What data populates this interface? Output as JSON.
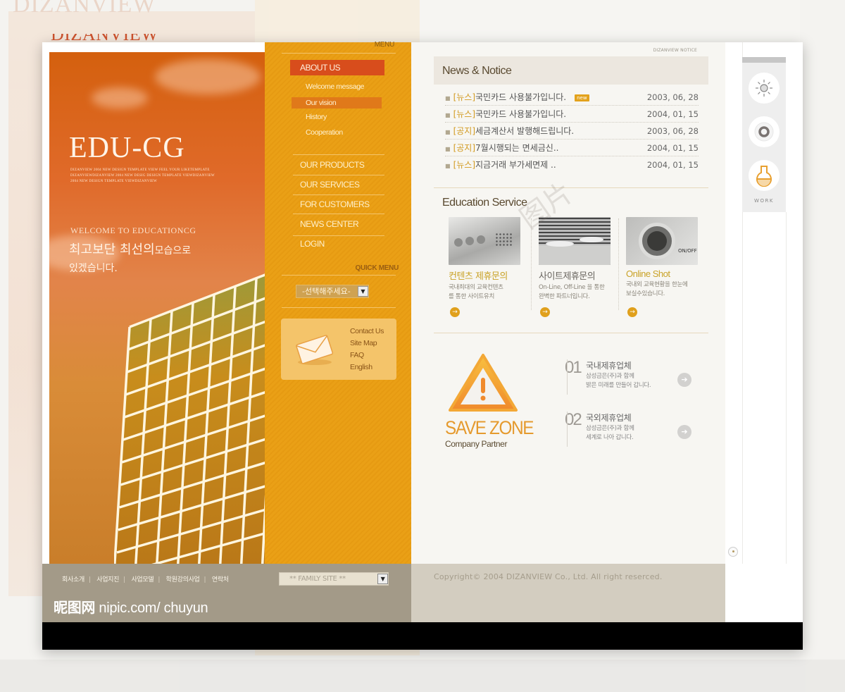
{
  "brand": {
    "logo": "DIZANVIEW"
  },
  "hero": {
    "title": "EDU-CG",
    "fine_print": "DIZANVIEW 2004 NEW DESIGN TEMPLATE VIEW FEEL YOUR LIKETEMPLATE DIZANVIEWDIZANVIEW 2004 NEW DESIG DESIGN TEMPLATE VIEWDIZANVIEW 2004 NEW DESIGN TEMPLATE VIEWDIZANVIEW",
    "welcome": "WELCOME TO EDUCATIONCG",
    "slogan_big": "최고보단 최선의",
    "slogan_small": "모습으로",
    "slogan_line2": "있겠습니다."
  },
  "menu": {
    "heading": "MENU",
    "active_section": "ABOUT US",
    "submenu": [
      {
        "label": "Welcome message",
        "active": false
      },
      {
        "label": "Our vision",
        "active": true
      },
      {
        "label": "History",
        "active": false
      },
      {
        "label": "Cooperation",
        "active": false
      }
    ],
    "items": [
      "OUR PRODUCTS",
      "OUR SERVICES",
      "FOR CUSTOMERS",
      "NEWS CENTER",
      "LOGIN"
    ],
    "quick_menu_label": "QUICK MENU",
    "quick_select_value": "-선택해주세요-",
    "contact_links": [
      "Contact Us",
      "Site Map",
      "FAQ",
      "English"
    ]
  },
  "news": {
    "corner_label": "DIZANVIEW NOTICE",
    "title": "News & Notice",
    "new_badge": "new",
    "rows": [
      {
        "tag": "[뉴스]",
        "text": "국민카드 사용불가입니다.",
        "date": "2003, 06, 28",
        "is_new": true
      },
      {
        "tag": "[뉴스]",
        "text": "국민카드 사용불가입니다.",
        "date": "2004, 01, 15",
        "is_new": false
      },
      {
        "tag": "[공지]",
        "text": "세금계산서 발행해드립니다.",
        "date": "2003, 06, 28",
        "is_new": false
      },
      {
        "tag": "[공지]",
        "text": "7월시행되는 면세금신..",
        "date": "2004, 01, 15",
        "is_new": false
      },
      {
        "tag": "[뉴스]",
        "text": "지금거래 부가세면제 ..",
        "date": "2004, 01, 15",
        "is_new": false
      }
    ]
  },
  "education": {
    "title": "Education Service",
    "services": [
      {
        "name": "컨텐츠 제휴문의",
        "desc1": "국내최대의 교육컨텐츠",
        "desc2": "를 통한 사이트유치",
        "color": "#c9a227"
      },
      {
        "name": "사이트제휴문의",
        "desc1": "On-Line, Off-Line 을 통한",
        "desc2": "완벽한 파트너입니다.",
        "color": "#6a6660"
      },
      {
        "name": "Online Shot",
        "desc1": "국내외 교육현황을 한눈에",
        "desc2": "보실수있습니다.",
        "color": "#c9a227"
      }
    ],
    "go_icon": "→"
  },
  "savezone": {
    "title": "SAVE ZONE",
    "subtitle": "Company Partner",
    "partners": [
      {
        "num": "01",
        "title": "국내제휴업체",
        "desc1": "삼성금은(주)과 함께",
        "desc2": "밝은 미래를 만들어 갑니다."
      },
      {
        "num": "02",
        "title": "국외제휴업체",
        "desc1": "삼성금은(주)과 함께",
        "desc2": "세계로 나아 갑니다."
      }
    ]
  },
  "rail": {
    "work_label": "WORK"
  },
  "footer": {
    "links": [
      "회사소개",
      "사업지진",
      "사업모델",
      "학원강의사업",
      "연락처"
    ],
    "family_site": "** FAMILY SITE **",
    "watermark_cn": "昵图网",
    "watermark_url": "nipic.com/ chuyun",
    "copyright": "Copyright© 2004 DIZANVIEW Co., Ltd. All right reserced."
  },
  "colors": {
    "menu_orange": "#eaa016",
    "active_red": "#d84d1c",
    "accent_gold": "#e0a01c",
    "footer_left": "#a39a88",
    "footer_right": "#d3cdc0"
  }
}
